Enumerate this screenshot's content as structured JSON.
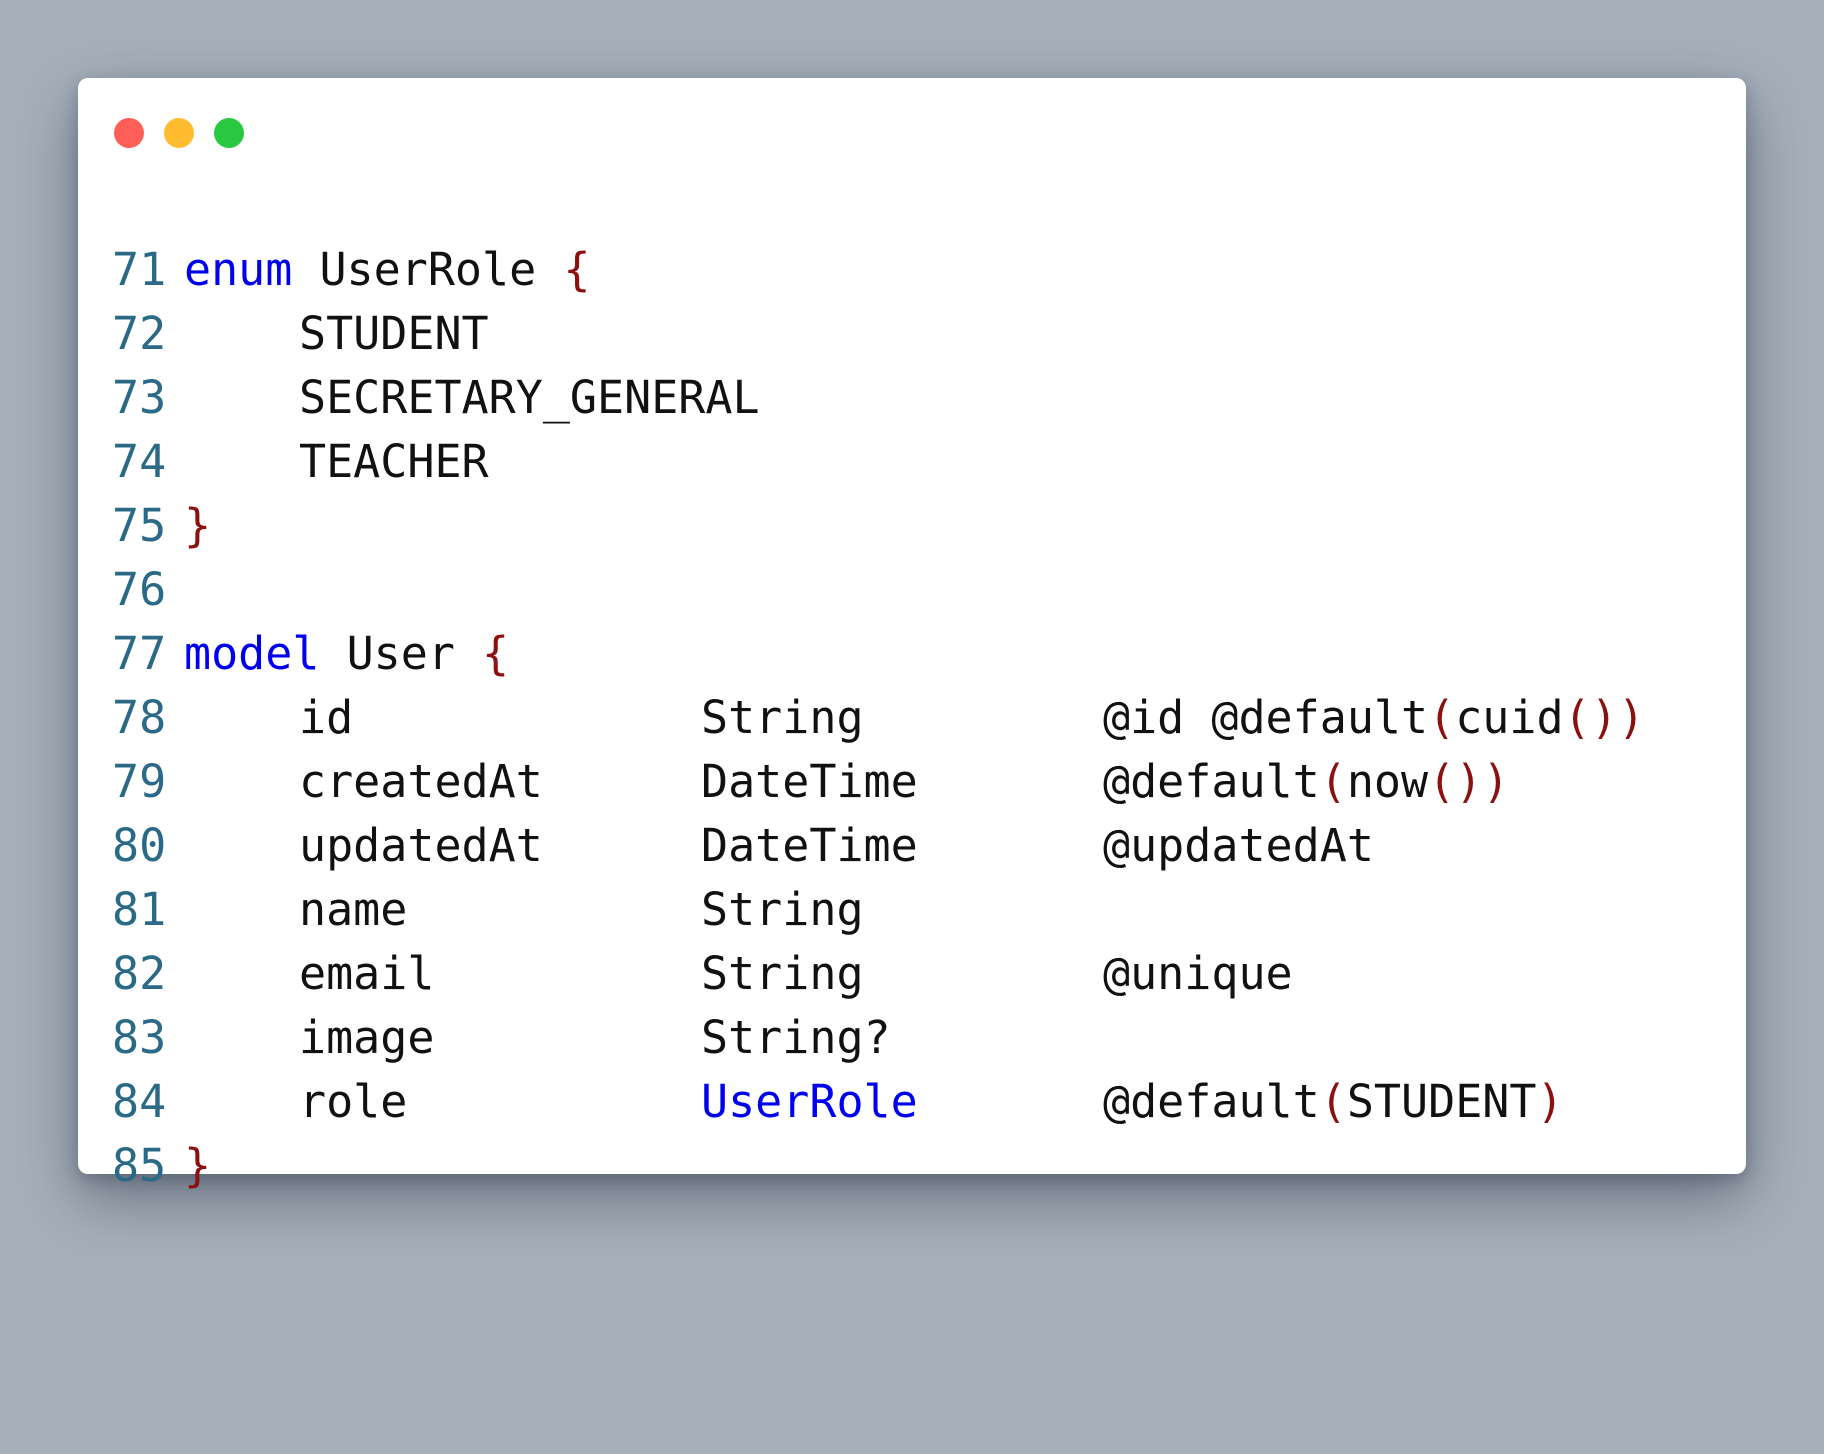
{
  "window": {
    "controls": [
      {
        "name": "close",
        "color": "#ff5f57"
      },
      {
        "name": "minimize",
        "color": "#febc2e"
      },
      {
        "name": "maximize",
        "color": "#28c840"
      }
    ]
  },
  "colors": {
    "keyword": "#0000ee",
    "bracket": "#8b1010",
    "line_number": "#2b6a87",
    "text": "#111111",
    "background": "#a6b0bb"
  },
  "code": {
    "lines": [
      {
        "n": "71",
        "keyword": "enum",
        "name": "UserRole",
        "brace": "{"
      },
      {
        "n": "72",
        "field": "STUDENT"
      },
      {
        "n": "73",
        "field": "SECRETARY_GENERAL"
      },
      {
        "n": "74",
        "field": "TEACHER"
      },
      {
        "n": "75",
        "brace": "}"
      },
      {
        "n": "76"
      },
      {
        "n": "77",
        "keyword": "model",
        "name": "User",
        "brace": "{"
      },
      {
        "n": "78",
        "field": "id",
        "type": "String",
        "attr": "@id @default",
        "paren1": "(",
        "arg": "cuid",
        "paren2": "()",
        "paren3": ")"
      },
      {
        "n": "79",
        "field": "createdAt",
        "type": "DateTime",
        "attr": "@default",
        "paren1": "(",
        "arg": "now",
        "paren2": "()",
        "paren3": ")"
      },
      {
        "n": "80",
        "field": "updatedAt",
        "type": "DateTime",
        "attr": "@updatedAt"
      },
      {
        "n": "81",
        "field": "name",
        "type": "String"
      },
      {
        "n": "82",
        "field": "email",
        "type": "String",
        "attr": "@unique"
      },
      {
        "n": "83",
        "field": "image",
        "type": "String?"
      },
      {
        "n": "84",
        "field": "role",
        "type": "UserRole",
        "attr": "@default",
        "paren1": "(",
        "arg": "STUDENT",
        "paren3": ")"
      },
      {
        "n": "85",
        "brace": "}"
      }
    ]
  }
}
